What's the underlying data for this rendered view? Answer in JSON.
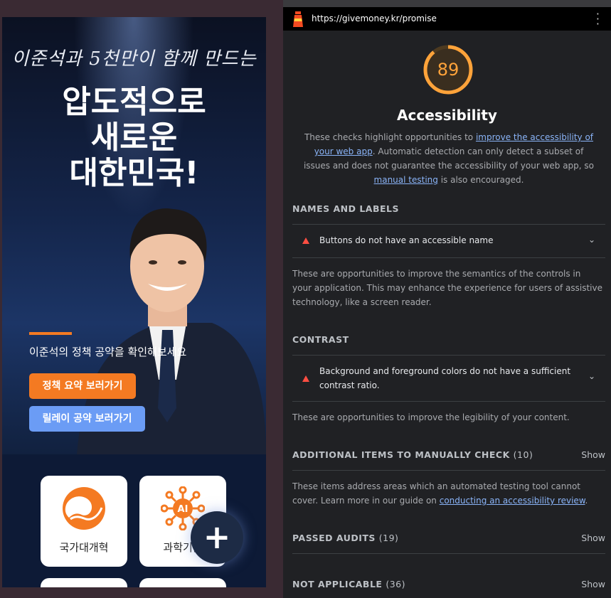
{
  "page": {
    "slogan": "이준석과 5천만이 함께 만드는",
    "headline": [
      "압도적으로",
      "새로운",
      "대한민국!"
    ],
    "subtitle": "이준석의 정책 공약을 확인해보세요",
    "buttons": {
      "summary": "정책 요약 보러가기",
      "relay": "릴레이 공약 보러가기"
    },
    "cards": [
      {
        "label": "국가대개혁",
        "icon": "taegeuk-icon"
      },
      {
        "label": "과학기술",
        "icon": "ai-chip-icon"
      }
    ],
    "fab_icon": "plus-icon"
  },
  "lighthouse": {
    "url": "https://givemoney.kr/promise",
    "score": "89",
    "category": "Accessibility",
    "description": {
      "p1": "These checks highlight opportunities to ",
      "link1": "improve the accessibility of your web app",
      "p2": ". Automatic detection can only detect a subset of issues and does not guarantee the accessibility of your web app, so ",
      "link2": "manual testing",
      "p3": " is also encouraged."
    },
    "groups": {
      "names_labels": {
        "title": "NAMES AND LABELS",
        "audit": "Buttons do not have an accessible name",
        "desc": "These are opportunities to improve the semantics of the controls in your application. This may enhance the experience for users of assistive technology, like a screen reader."
      },
      "contrast": {
        "title": "CONTRAST",
        "audit": "Background and foreground colors do not have a sufficient contrast ratio.",
        "desc": "These are opportunities to improve the legibility of your content."
      },
      "manual": {
        "title": "ADDITIONAL ITEMS TO MANUALLY CHECK",
        "count": "(10)",
        "show": "Show",
        "desc_p1": "These items address areas which an automated testing tool cannot cover. Learn more in our guide on ",
        "desc_link": "conducting an accessibility review",
        "desc_p2": "."
      },
      "passed": {
        "title": "PASSED AUDITS",
        "count": "(19)",
        "show": "Show"
      },
      "not_applicable": {
        "title": "NOT APPLICABLE",
        "count": "(36)",
        "show": "Show"
      }
    }
  },
  "colors": {
    "accent_orange": "#f47a22",
    "accent_blue": "#6b9cf5",
    "score_color": "#ffa33a",
    "fail_red": "#ff4e42",
    "link": "#8ab4f8"
  }
}
